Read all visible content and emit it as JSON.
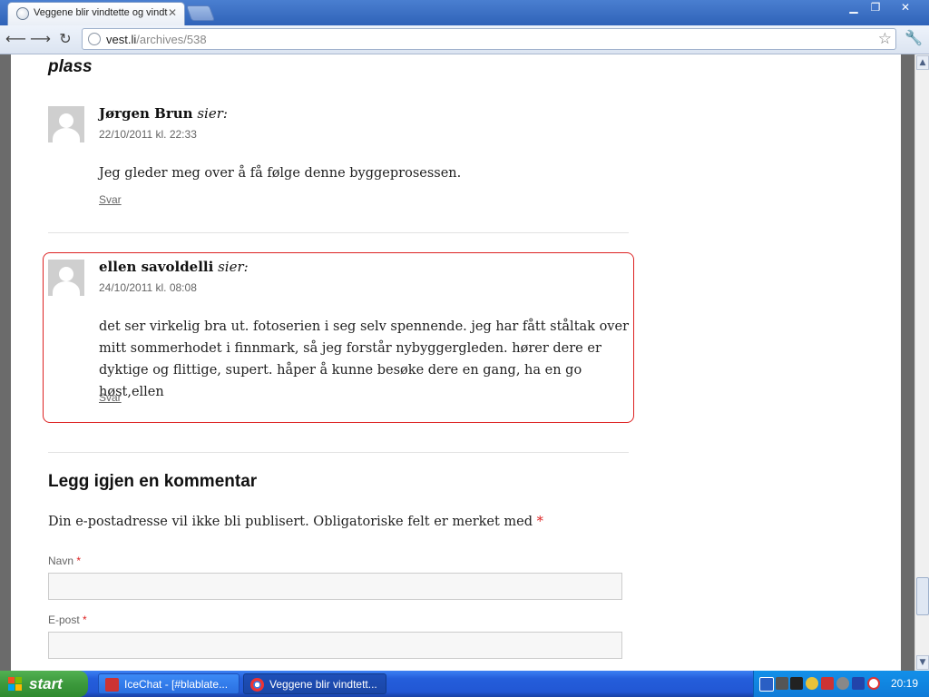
{
  "browser": {
    "tab_title": "Veggene blir vindtette og vindt",
    "url_host": "vest.li",
    "url_path": "/archives/538"
  },
  "page": {
    "section_heading": "plass",
    "comments": [
      {
        "author": "Jørgen Brun",
        "says": "sier:",
        "date": "22/10/2011 kl. 22:33",
        "text": "Jeg gleder meg over å få følge denne byggeprosessen.",
        "reply": "Svar"
      },
      {
        "author": "ellen savoldelli",
        "says": "sier:",
        "date": "24/10/2011 kl. 08:08",
        "text": "det ser virkelig bra ut. fotoserien i seg selv spennende. jeg har fått ståltak over mitt sommerhodet i finnmark, så jeg forstår nybyggergleden. hører dere er dyktige og flittige, supert. håper å kunne besøke dere en gang, ha en go høst,ellen",
        "reply": "Svar"
      }
    ],
    "reply_form": {
      "title": "Legg igjen en kommentar",
      "notes": "Din e-postadresse vil ikke bli publisert. Obligatoriske felt er merket med",
      "required_mark": "*",
      "name_label": "Navn",
      "email_label": "E-post"
    }
  },
  "taskbar": {
    "start_label": "start",
    "tasks": [
      {
        "label": "IceChat - [#blablate..."
      },
      {
        "label": "Veggene blir vindtett..."
      }
    ],
    "clock": "20:19"
  },
  "colors": {
    "highlight_border": "#dd2222",
    "required": "#dd2222"
  }
}
